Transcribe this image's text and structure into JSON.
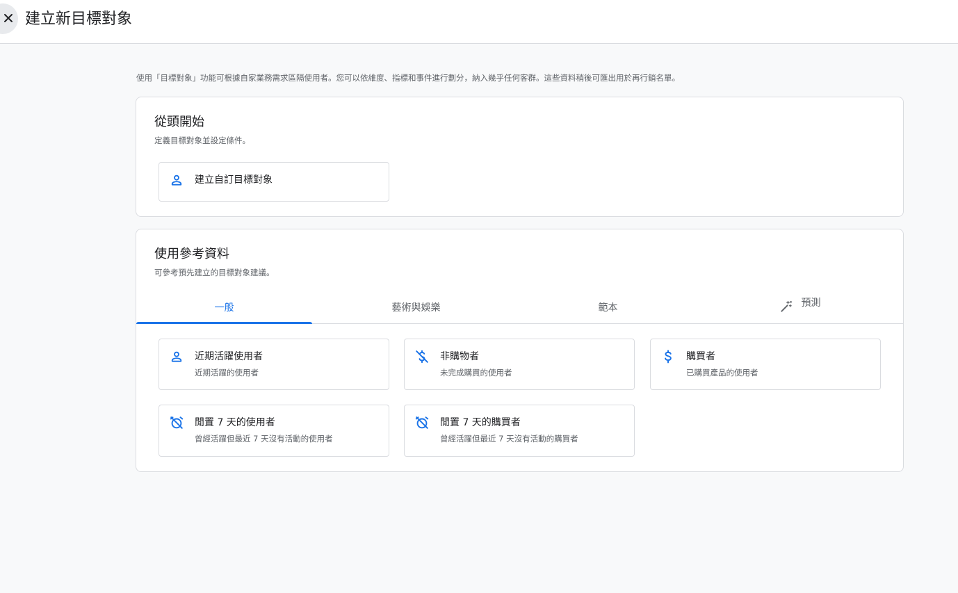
{
  "header": {
    "title": "建立新目標對象"
  },
  "intro": "使用「目標對象」功能可根據自家業務需求區隔使用者。您可以依維度、指標和事件進行劃分，納入幾乎任何客群。這些資料稍後可匯出用於再行銷名單。",
  "scratch": {
    "title": "從頭開始",
    "subtitle": "定義目標對象並設定條件。",
    "custom_button": "建立自訂目標對象"
  },
  "suggested": {
    "title": "使用參考資料",
    "subtitle": "可參考預先建立的目標對象建議。",
    "tabs": [
      {
        "label": "一般",
        "active": true
      },
      {
        "label": "藝術與娛樂",
        "active": false
      },
      {
        "label": "範本",
        "active": false
      },
      {
        "label": "預測",
        "active": false,
        "icon": "magic-wand-icon"
      }
    ],
    "items": [
      {
        "title": "近期活躍使用者",
        "desc": "近期活躍的使用者",
        "icon": "person-icon"
      },
      {
        "title": "非購物者",
        "desc": "未完成購買的使用者",
        "icon": "money-off-icon"
      },
      {
        "title": "購買者",
        "desc": "已購買產品的使用者",
        "icon": "dollar-icon"
      },
      {
        "title": "閒置 7 天的使用者",
        "desc": "曾經活躍但最近 7 天沒有活動的使用者",
        "icon": "alarm-off-icon"
      },
      {
        "title": "閒置 7 天的購買者",
        "desc": "曾經活躍但最近 7 天沒有活動的購買者",
        "icon": "alarm-off-icon"
      }
    ]
  },
  "colors": {
    "accent": "#1a73e8",
    "border": "#dadce0",
    "background": "#f8f9fa",
    "secondary_text": "#5f6368"
  }
}
